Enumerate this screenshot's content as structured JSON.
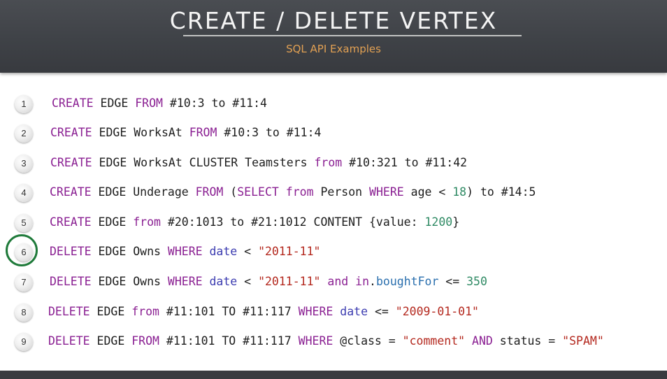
{
  "header": {
    "title": "CREATE / DELETE VERTEX",
    "subtitle": "SQL API Examples"
  },
  "lines": [
    {
      "number": "1",
      "tokens": [
        {
          "t": "CREATE",
          "c": "kw"
        },
        {
          "t": " EDGE ",
          "c": ""
        },
        {
          "t": "FROM",
          "c": "kw"
        },
        {
          "t": " #10:3 to #11:4",
          "c": ""
        }
      ]
    },
    {
      "number": "2",
      "tokens": [
        {
          "t": "CREATE",
          "c": "kw"
        },
        {
          "t": " EDGE WorksAt ",
          "c": ""
        },
        {
          "t": "FROM",
          "c": "kw"
        },
        {
          "t": " #10:3 to #11:4",
          "c": ""
        }
      ]
    },
    {
      "number": "3",
      "tokens": [
        {
          "t": "CREATE",
          "c": "kw"
        },
        {
          "t": " EDGE WorksAt CLUSTER Teamsters ",
          "c": ""
        },
        {
          "t": "from",
          "c": "kw"
        },
        {
          "t": " #10:321 to #11:42",
          "c": ""
        }
      ]
    },
    {
      "number": "4",
      "tokens": [
        {
          "t": "CREATE",
          "c": "kw"
        },
        {
          "t": " EDGE Underage ",
          "c": ""
        },
        {
          "t": "FROM",
          "c": "kw"
        },
        {
          "t": " (",
          "c": ""
        },
        {
          "t": "SELECT",
          "c": "kw"
        },
        {
          "t": " ",
          "c": ""
        },
        {
          "t": "from",
          "c": "kw"
        },
        {
          "t": " Person ",
          "c": ""
        },
        {
          "t": "WHERE",
          "c": "kw"
        },
        {
          "t": " age < ",
          "c": ""
        },
        {
          "t": "18",
          "c": "numlit"
        },
        {
          "t": ") to #14:5",
          "c": ""
        }
      ]
    },
    {
      "number": "5",
      "tokens": [
        {
          "t": "CREATE",
          "c": "kw"
        },
        {
          "t": " EDGE ",
          "c": ""
        },
        {
          "t": "from",
          "c": "kw"
        },
        {
          "t": " #20:1013 to #21:1012 CONTENT {value: ",
          "c": ""
        },
        {
          "t": "1200",
          "c": "numlit"
        },
        {
          "t": "}",
          "c": ""
        }
      ]
    },
    {
      "number": "6",
      "tokens": [
        {
          "t": "DELETE",
          "c": "kw"
        },
        {
          "t": " EDGE Owns ",
          "c": ""
        },
        {
          "t": "WHERE",
          "c": "kw"
        },
        {
          "t": " ",
          "c": ""
        },
        {
          "t": "date",
          "c": "fld"
        },
        {
          "t": " < ",
          "c": ""
        },
        {
          "t": "\"2011-11\"",
          "c": "str"
        }
      ]
    },
    {
      "number": "7",
      "tokens": [
        {
          "t": "DELETE",
          "c": "kw"
        },
        {
          "t": " EDGE Owns ",
          "c": ""
        },
        {
          "t": "WHERE",
          "c": "kw"
        },
        {
          "t": " ",
          "c": ""
        },
        {
          "t": "date",
          "c": "fld"
        },
        {
          "t": " < ",
          "c": ""
        },
        {
          "t": "\"2011-11\"",
          "c": "str"
        },
        {
          "t": " ",
          "c": ""
        },
        {
          "t": "and",
          "c": "kw"
        },
        {
          "t": " ",
          "c": ""
        },
        {
          "t": "in",
          "c": "kw"
        },
        {
          "t": ".",
          "c": ""
        },
        {
          "t": "boughtFor",
          "c": "prop"
        },
        {
          "t": " <= ",
          "c": ""
        },
        {
          "t": "350",
          "c": "numlit"
        }
      ]
    },
    {
      "number": "8",
      "tokens": [
        {
          "t": "DELETE",
          "c": "kw"
        },
        {
          "t": " EDGE ",
          "c": ""
        },
        {
          "t": "from",
          "c": "kw"
        },
        {
          "t": " #11:101 TO #11:117 ",
          "c": ""
        },
        {
          "t": "WHERE",
          "c": "kw"
        },
        {
          "t": " ",
          "c": ""
        },
        {
          "t": "date",
          "c": "fld"
        },
        {
          "t": " <= ",
          "c": ""
        },
        {
          "t": "\"2009-01-01\"",
          "c": "str"
        }
      ]
    },
    {
      "number": "9",
      "tokens": [
        {
          "t": "DELETE",
          "c": "kw"
        },
        {
          "t": " EDGE ",
          "c": ""
        },
        {
          "t": "FROM",
          "c": "kw"
        },
        {
          "t": " #11:101 TO #11:117 ",
          "c": ""
        },
        {
          "t": "WHERE",
          "c": "kw"
        },
        {
          "t": " @class = ",
          "c": ""
        },
        {
          "t": "\"comment\"",
          "c": "str"
        },
        {
          "t": " ",
          "c": ""
        },
        {
          "t": "AND",
          "c": "kw"
        },
        {
          "t": " status = ",
          "c": ""
        },
        {
          "t": "\"SPAM\"",
          "c": "str"
        }
      ]
    }
  ],
  "highlighted_line": "6",
  "colors": {
    "keyword": "#8a1f92",
    "field": "#3b3bb0",
    "property": "#2a6fae",
    "string": "#b4291f",
    "number": "#2f8a64",
    "highlight_ring": "#1f7a3a",
    "subtitle": "#e1a053"
  }
}
